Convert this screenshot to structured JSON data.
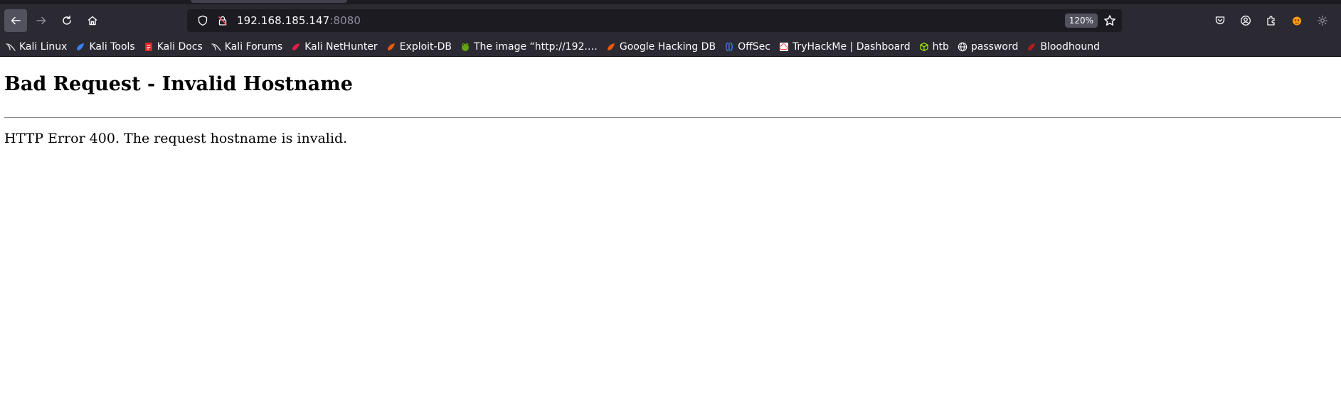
{
  "browser": {
    "url_host": "192.168.185.147",
    "url_port": ":8080",
    "zoom": "120%",
    "nav_icons": [
      "back-arrow-icon",
      "forward-arrow-icon",
      "reload-icon",
      "home-icon"
    ],
    "url_icons": [
      "shield-icon",
      "lock-strike-icon"
    ],
    "toolbar_icons": [
      "pocket-icon",
      "account-icon",
      "extensions-icon",
      "fox-icon",
      "settings-icon"
    ]
  },
  "bookmarks": [
    {
      "label": "Kali Linux",
      "icon": "kali-dragon-icon",
      "color": "#e6e6e6"
    },
    {
      "label": "Kali Tools",
      "icon": "kali-tools-icon",
      "color": "#3b82f6"
    },
    {
      "label": "Kali Docs",
      "icon": "kali-docs-icon",
      "color": "#dc2626"
    },
    {
      "label": "Kali Forums",
      "icon": "kali-dragon-icon",
      "color": "#e6e6e6"
    },
    {
      "label": "Kali NetHunter",
      "icon": "nethunter-icon",
      "color": "#e11d48"
    },
    {
      "label": "Exploit-DB",
      "icon": "exploit-db-icon",
      "color": "#ea580c"
    },
    {
      "label": "The image “http://192.…",
      "icon": "frog-icon",
      "color": "#65a30d"
    },
    {
      "label": "Google Hacking DB",
      "icon": "exploit-db-icon",
      "color": "#ea580c"
    },
    {
      "label": "OffSec",
      "icon": "offsec-icon",
      "color": "#3b82f6"
    },
    {
      "label": "TryHackMe | Dashboard",
      "icon": "tryhackme-icon",
      "color": "#ef4444"
    },
    {
      "label": "htb",
      "icon": "htb-cube-icon",
      "color": "#9fef00"
    },
    {
      "label": "password",
      "icon": "globe-icon",
      "color": "#fbfbfe"
    },
    {
      "label": "Bloodhound",
      "icon": "bloodhound-icon",
      "color": "#b91c1c"
    }
  ],
  "page": {
    "heading": "Bad Request - Invalid Hostname",
    "message": "HTTP Error 400. The request hostname is invalid."
  }
}
